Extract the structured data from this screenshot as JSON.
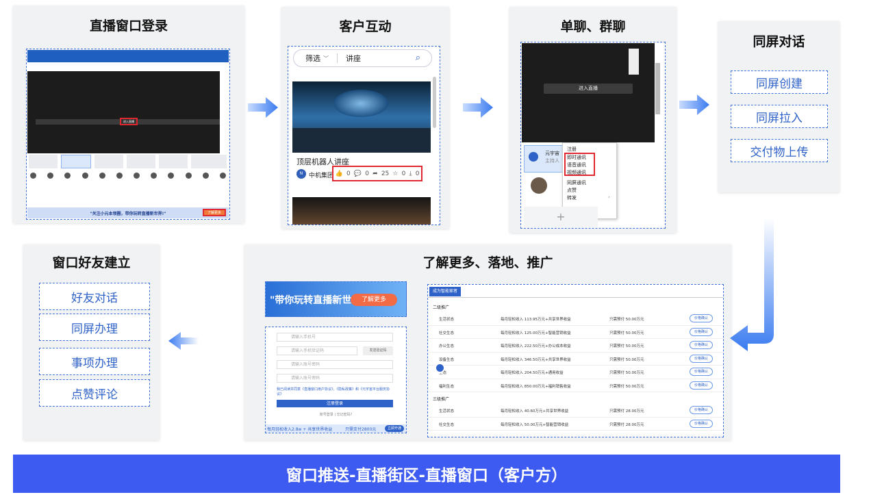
{
  "panels": {
    "p1": {
      "title": "直播窗口登录"
    },
    "p2": {
      "title": "客户互动"
    },
    "p3": {
      "title": "单聊、群聊"
    },
    "p4": {
      "title": "同屏对话",
      "items": [
        "同屏创建",
        "同屏拉入",
        "交付物上传"
      ]
    },
    "p5": {
      "title": "了解更多、落地、推广"
    },
    "p6": {
      "title": "窗口好友建立",
      "items": [
        "好友对话",
        "同屏办理",
        "事项办理",
        "点赞评论"
      ]
    }
  },
  "p1_shot": {
    "enter_button": "进入直播",
    "banner_text": "\"关注小元本领圈，带你玩转直播新世界!\"",
    "banner_button": "了解更多"
  },
  "p2_shot": {
    "filter_label": "筛选",
    "search_text": "讲座",
    "card_title": "顶层机器人讲座",
    "card_org": "中机集团",
    "stats": {
      "likes": "0",
      "comments": "0",
      "shares": "25",
      "favorites": "0",
      "downloads": "0"
    }
  },
  "p3_shot": {
    "enter_button": "进入直播",
    "contact_name": "元宇宙",
    "contact_sub": "主持人",
    "menu_items": [
      "注册",
      "即时通讯",
      "语音通讯",
      "视频通讯",
      "同屏通讯",
      "点赞",
      "转发"
    ],
    "add_symbol": "+"
  },
  "p5_shot": {
    "banner_text": "\"带你玩转直播新世界",
    "banner_button": "了解更多",
    "form_fields": [
      "请输入手机号",
      "请输入手机验证码",
      "请输入账号密码",
      "请输入账号密码"
    ],
    "send_code": "发送验证码",
    "agree_text": "我已阅读并同意《直播窗口用户协议》、《隐私政策》和《元宇宙平台服务协议》",
    "login_button": "注册登录",
    "form_links": "账号登录 | 忘记密码?",
    "promo_text": "每月轻松收入2.8w + 共享世界收益",
    "promo_price": "只需支付2800元",
    "promo_btn": "立即开通",
    "tab_label": "成为智能家者",
    "section1": "二级推广",
    "section2": "三级推广",
    "btn_label": "价格确认",
    "rows1": [
      {
        "name": "生活状态",
        "income": "每月轻松收入 113.95万元+共享世界收益",
        "price": "只需预付 50.00万元"
      },
      {
        "name": "社交生态",
        "income": "每月轻松收入 125.00万元+智能营销收益",
        "price": "只需预付 50.00万元"
      },
      {
        "name": "办公生态",
        "income": "每月轻松收入 222.50万元+办公成本收益",
        "price": "只需预付 50.00万元"
      },
      {
        "name": "设备生态",
        "income": "每月轻松收入 346.50万元+共享世界收益",
        "price": "只需预付 50.00万元"
      },
      {
        "name": "生态",
        "income": "每月轻松收入 204.50万元+通用收益",
        "price": "只需预付 50.00万元"
      },
      {
        "name": "福利生态",
        "income": "每月轻松收入 850.00万元+福利销售收益",
        "price": "只需预付 50.00万元"
      }
    ],
    "rows2": [
      {
        "name": "生活状态",
        "income": "每月轻松收入 40.60万元+共享世界收益",
        "price": "只需预付 28.00万元"
      },
      {
        "name": "社交生态",
        "income": "每月轻松收入 50.00万元+智能营销收益",
        "price": "只需预付 28.00万元"
      }
    ]
  },
  "footer": {
    "text": "窗口推送-直播街区-直播窗口（客户方）"
  },
  "colors": {
    "accent": "#3d5af1",
    "dash": "#3d6fd8",
    "highlight": "#e0262f",
    "arrow": "#3a7bf0"
  }
}
